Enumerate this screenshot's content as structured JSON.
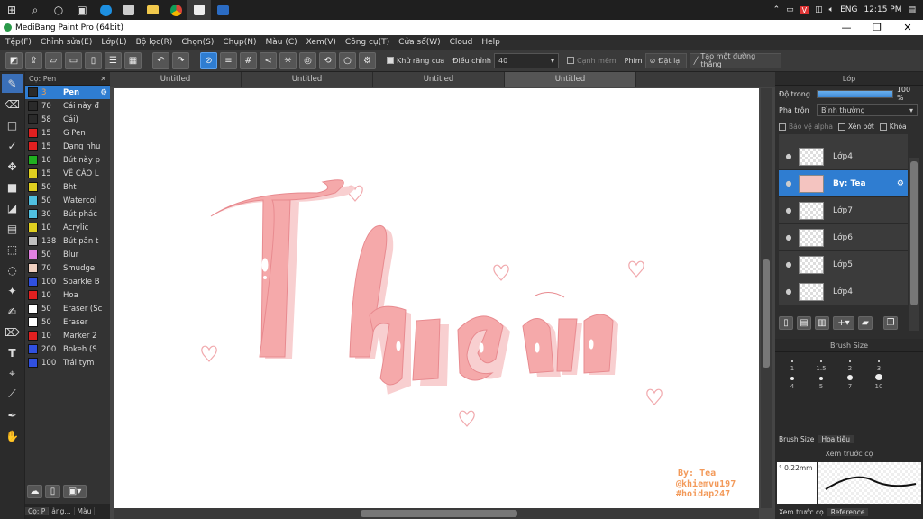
{
  "taskbar": {
    "time": "12:15 PM",
    "language": "ENG"
  },
  "window": {
    "title": "MediBang Paint Pro (64bit)"
  },
  "menu": [
    "Tệp(F)",
    "Chỉnh sửa(E)",
    "Lớp(L)",
    "Bộ lọc(R)",
    "Chọn(S)",
    "Chụp(N)",
    "Màu (C)",
    "Xem(V)",
    "Công cụ(T)",
    "Cửa sổ(W)",
    "Cloud",
    "Help"
  ],
  "toolbar": {
    "antialias_label": "Khử răng cưa",
    "adjust_label": "Điều chỉnh",
    "adjust_value": "40",
    "smooth_edge_label": "Cạnh mềm",
    "shortcut_label": "Phím",
    "reset_label": "Đặt lại",
    "straight_line_label": "Tạo một đường thẳng"
  },
  "brush_panel": {
    "title": "Cọ: Pen",
    "brushes": [
      {
        "size": "3",
        "name": "Pen",
        "color": "#2a2a2a"
      },
      {
        "size": "70",
        "name": "Cái này đ",
        "color": "#2a2a2a"
      },
      {
        "size": "58",
        "name": "Cái)",
        "color": "#2a2a2a"
      },
      {
        "size": "15",
        "name": "G Pen",
        "color": "#e02020"
      },
      {
        "size": "15",
        "name": "Dạng nhu",
        "color": "#e02020"
      },
      {
        "size": "10",
        "name": "Bút này p",
        "color": "#20b020"
      },
      {
        "size": "15",
        "name": "VẼ CÁO L",
        "color": "#e0d020"
      },
      {
        "size": "50",
        "name": "Bht",
        "color": "#e0d020"
      },
      {
        "size": "50",
        "name": "Watercol",
        "color": "#50c0e0"
      },
      {
        "size": "30",
        "name": "Bút phác",
        "color": "#50c0e0"
      },
      {
        "size": "10",
        "name": "Acrylic",
        "color": "#e0d020"
      },
      {
        "size": "138",
        "name": "Bút pân t",
        "color": "#c0c0c0"
      },
      {
        "size": "50",
        "name": "Blur",
        "color": "#e080e0"
      },
      {
        "size": "70",
        "name": "Smudge",
        "color": "#f0d0c0"
      },
      {
        "size": "100",
        "name": "Sparkle B",
        "color": "#3050e0"
      },
      {
        "size": "10",
        "name": "Hoa",
        "color": "#e02020"
      },
      {
        "size": "50",
        "name": "Eraser (Sc",
        "color": "#ffffff"
      },
      {
        "size": "50",
        "name": "Eraser",
        "color": "#ffffff"
      },
      {
        "size": "10",
        "name": "Marker 2",
        "color": "#e02020"
      },
      {
        "size": "200",
        "name": "Bokeh (S",
        "color": "#3050e0"
      },
      {
        "size": "100",
        "name": "Trái tym",
        "color": "#3050e0"
      }
    ],
    "bottom_tabs": [
      "Cọ: P",
      "ảng...",
      "Màu"
    ]
  },
  "tabs": [
    "Untitled",
    "Untitled",
    "Untitled",
    "Untitled"
  ],
  "canvas": {
    "artwork_text": "Thục nữ",
    "signature": [
      "By: Tea",
      "@khiemvu197",
      "#hoidap247"
    ]
  },
  "layer_panel": {
    "title": "Lớp",
    "opacity_label": "Độ trong",
    "opacity_value": "100 %",
    "blend_label": "Pha trộn",
    "blend_value": "Bình thường",
    "protect_alpha": "Bảo vệ alpha",
    "clipping": "Xén bớt",
    "lock": "Khóa",
    "layers": [
      {
        "name": "Lớp4",
        "selected": false
      },
      {
        "name": "By: Tea",
        "selected": true
      },
      {
        "name": "Lớp7",
        "selected": false
      },
      {
        "name": "Lớp6",
        "selected": false
      },
      {
        "name": "Lớp5",
        "selected": false
      },
      {
        "name": "Lớp4",
        "selected": false
      }
    ]
  },
  "brush_size_panel": {
    "title": "Brush Size",
    "sizes": [
      "1",
      "1.5",
      "2",
      "3",
      "4",
      "5",
      "7",
      "10"
    ],
    "tabs": [
      "Brush Size",
      "Hoa tiêu"
    ]
  },
  "preview_panel": {
    "title": "Xem trước cọ",
    "size": "0.22mm",
    "tabs": [
      "Xem trước cọ",
      "Reference"
    ]
  },
  "colors": {
    "accent": "#2f7dd1",
    "artwork_pink": "#f4a7a7"
  }
}
